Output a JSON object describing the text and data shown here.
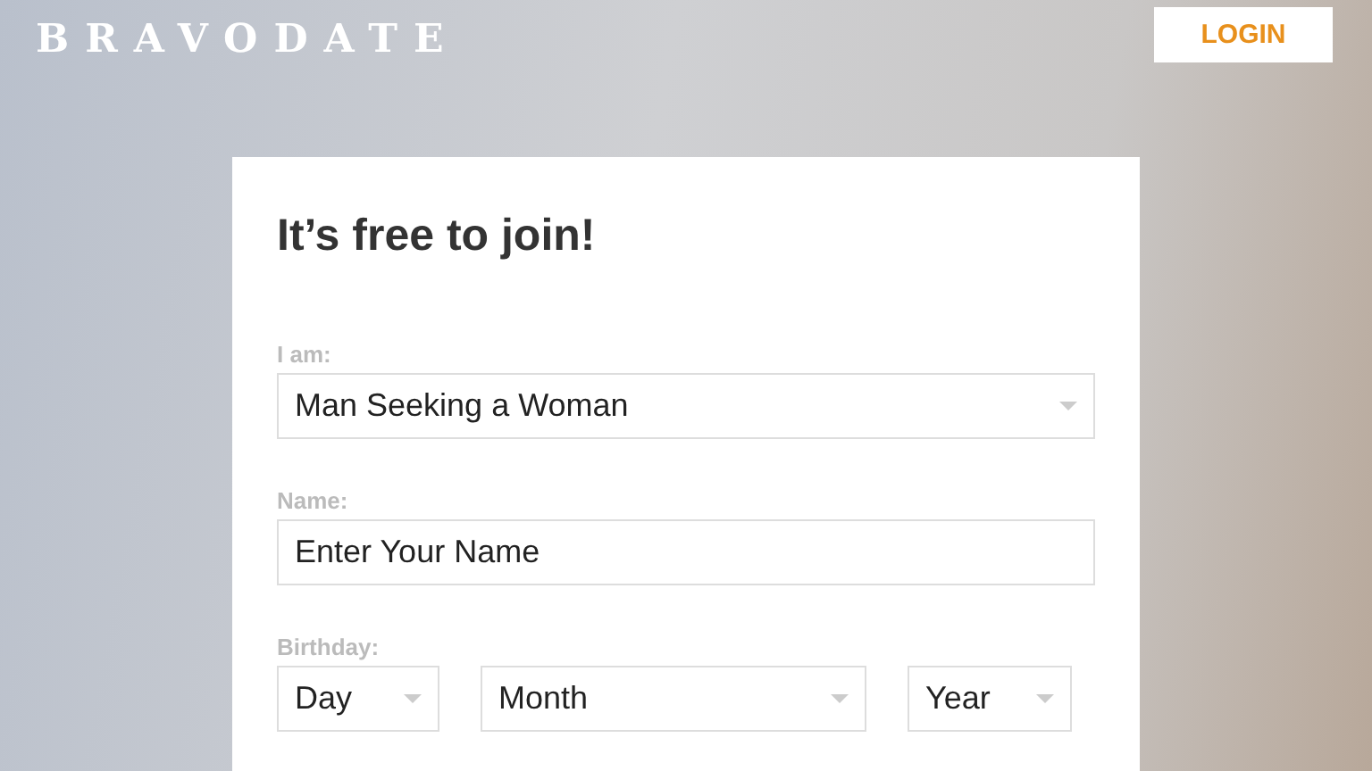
{
  "header": {
    "logo": "BRAVODATE",
    "login_button": "LOGIN"
  },
  "form": {
    "title": "It’s free to join!",
    "fields": [
      {
        "kind": "select",
        "label": "I am:",
        "value": "Man Seeking a Woman"
      },
      {
        "kind": "text",
        "label": "Name:",
        "placeholder": "Enter Your Name"
      }
    ],
    "birthday": {
      "label": "Birthday:",
      "selects": [
        {
          "value": "Day"
        },
        {
          "value": "Month"
        },
        {
          "value": "Year"
        }
      ]
    }
  }
}
